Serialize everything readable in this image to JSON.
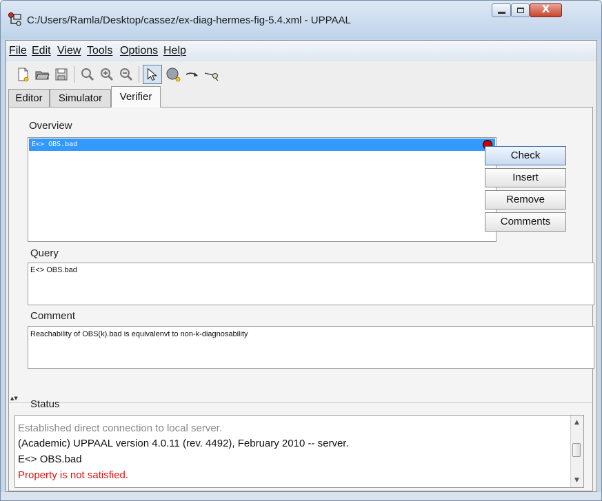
{
  "window": {
    "title": "C:/Users/Ramla/Desktop/cassez/ex-diag-hermes-fig-5.4.xml - UPPAAL",
    "close_glyph": "X"
  },
  "menu": {
    "items": [
      {
        "label": "File"
      },
      {
        "label": "Edit"
      },
      {
        "label": "View"
      },
      {
        "label": "Tools"
      },
      {
        "label": "Options"
      },
      {
        "label": "Help"
      }
    ]
  },
  "toolbar": {
    "icons": [
      "new-document-icon",
      "open-folder-icon",
      "save-icon",
      "zoom-icon",
      "zoom-in-icon",
      "zoom-out-icon",
      "select-arrow-icon",
      "add-location-icon",
      "add-edge-icon",
      "add-nail-icon"
    ]
  },
  "tabs": [
    {
      "label": "Editor"
    },
    {
      "label": "Simulator"
    },
    {
      "label": "Verifier",
      "active": true
    }
  ],
  "overview": {
    "label": "Overview",
    "queries": [
      {
        "text": "E<> OBS.bad",
        "selected": true,
        "result_color": "#cc0000"
      }
    ]
  },
  "buttons": {
    "check": "Check",
    "insert": "Insert",
    "remove": "Remove",
    "comments": "Comments"
  },
  "query": {
    "label": "Query",
    "value": "E<> OBS.bad"
  },
  "comment": {
    "label": "Comment",
    "value": "Reachability of OBS(k).bad is equivalenvt to non-k-diagnosability"
  },
  "status": {
    "label": "Status",
    "lines": [
      {
        "text": "Established direct connection to local server.",
        "color": "#888888"
      },
      {
        "text": "(Academic) UPPAAL version 4.0.11 (rev. 4492), February 2010 -- server.",
        "color": "#111111"
      },
      {
        "text": "E<> OBS.bad",
        "color": "#111111"
      },
      {
        "text": "Property is not satisfied.",
        "color": "#dd1111"
      }
    ]
  },
  "colors": {
    "selection": "#3399ff",
    "error": "#dd1111"
  }
}
